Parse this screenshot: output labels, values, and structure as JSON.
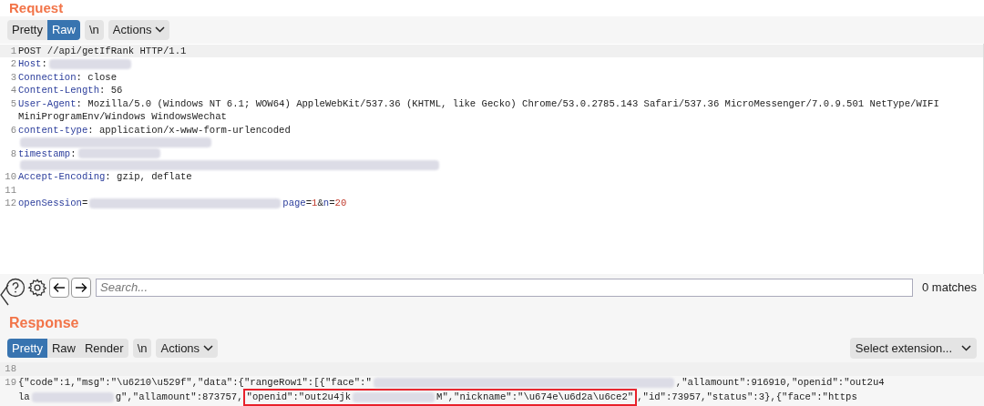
{
  "request": {
    "title": "Request",
    "view_tabs": [
      {
        "label": "Pretty",
        "selected": false
      },
      {
        "label": "Raw",
        "selected": true
      }
    ],
    "newline_toggle": "\\n",
    "actions": "Actions",
    "lines": [
      {
        "number": "1",
        "parts": [
          {
            "kind": "text",
            "text": "POST //api/getIfRank HTTP/1.1"
          }
        ]
      },
      {
        "number": "2",
        "parts": [
          {
            "kind": "key",
            "text": "Host"
          },
          {
            "kind": "text",
            "text": ":"
          },
          {
            "kind": "blur_medium"
          }
        ]
      },
      {
        "number": "3",
        "parts": [
          {
            "kind": "key",
            "text": "Connection"
          },
          {
            "kind": "text",
            "text": ": close"
          }
        ]
      },
      {
        "number": "4",
        "parts": [
          {
            "kind": "key",
            "text": "Content-Length"
          },
          {
            "kind": "text",
            "text": ": 56"
          }
        ]
      },
      {
        "number": "5",
        "parts": [
          {
            "kind": "key",
            "text": "User-Agent"
          },
          {
            "kind": "text",
            "text": ": Mozilla/5.0 (Windows NT 6.1; WOW64) AppleWebKit/537.36 (KHTML, like Gecko) Chrome/53.0.2785.143 Safari/537.36 MicroMessenger/7.0.9.501 NetType/WIFI"
          }
        ]
      },
      {
        "parts": [
          {
            "kind": "text",
            "text": "MiniProgramEnv/Windows WindowsWechat"
          }
        ]
      },
      {
        "number": "6",
        "parts": [
          {
            "kind": "key",
            "text": "content-type"
          },
          {
            "kind": "text",
            "text": ": application/x-www-form-urlencoded"
          }
        ]
      },
      {
        "parts": [
          {
            "kind": "blur_long"
          }
        ]
      },
      {
        "number": "8",
        "parts": [
          {
            "kind": "key",
            "text": "timestamp"
          },
          {
            "kind": "text",
            "text": ":"
          },
          {
            "kind": "blur_medium"
          }
        ]
      },
      {
        "parts": [
          {
            "kind": "blur_full"
          }
        ]
      },
      {
        "number": "10",
        "parts": [
          {
            "kind": "key",
            "text": "Accept-Encoding"
          },
          {
            "kind": "text",
            "text": ": gzip, deflate"
          }
        ]
      },
      {
        "number": "11"
      },
      {
        "number": "12",
        "parts": [
          {
            "kind": "key",
            "text": "openSession"
          },
          {
            "kind": "text",
            "text": "="
          },
          {
            "kind": "blur_long"
          },
          {
            "kind": "key",
            "text": "page"
          },
          {
            "kind": "text",
            "text": "="
          },
          {
            "kind": "num",
            "text": "1"
          },
          {
            "kind": "text",
            "text": "&"
          },
          {
            "kind": "key",
            "text": "n"
          },
          {
            "kind": "text",
            "text": "="
          },
          {
            "kind": "num",
            "text": "20"
          }
        ]
      }
    ]
  },
  "search": {
    "placeholder": "Search...",
    "matches": "0 matches"
  },
  "response": {
    "title": "Response",
    "view_tabs": [
      {
        "label": "Pretty",
        "selected": true
      },
      {
        "label": "Raw",
        "selected": false
      },
      {
        "label": "Render",
        "selected": false
      }
    ],
    "newline_toggle": "\\n",
    "actions": "Actions",
    "extension_select": "Select extension...",
    "lines": [
      {
        "number": "18"
      },
      {
        "number": "19",
        "parts": [
          {
            "kind": "text",
            "text": "{\"code\":1,\"msg\":\"\\u6210\\u529f\",\"data\":{\"rangeRow1\":[{\"face\":\""
          },
          {
            "kind": "blur_xlong"
          },
          {
            "kind": "text",
            "text": ",\"allamount\":916910,\"openid\":\"out2u4"
          }
        ]
      },
      {
        "parts": [
          {
            "kind": "text",
            "text": "la"
          },
          {
            "kind": "blur_medium"
          },
          {
            "kind": "text",
            "text": "g\",\"allamount\":873757,"
          },
          {
            "kind": "boxed",
            "parts": [
              {
                "kind": "text",
                "text": "\"openid\":\"out2u4jk"
              },
              {
                "kind": "blur_medium"
              },
              {
                "kind": "text",
                "text": "M\",\"nickname\":\"\\u674e\\u6d2a\\u6ce2\""
              }
            ]
          },
          {
            "kind": "text",
            "text": ",\"id\":73957,\"status\":3},{\"face\":\"https"
          }
        ]
      }
    ]
  }
}
